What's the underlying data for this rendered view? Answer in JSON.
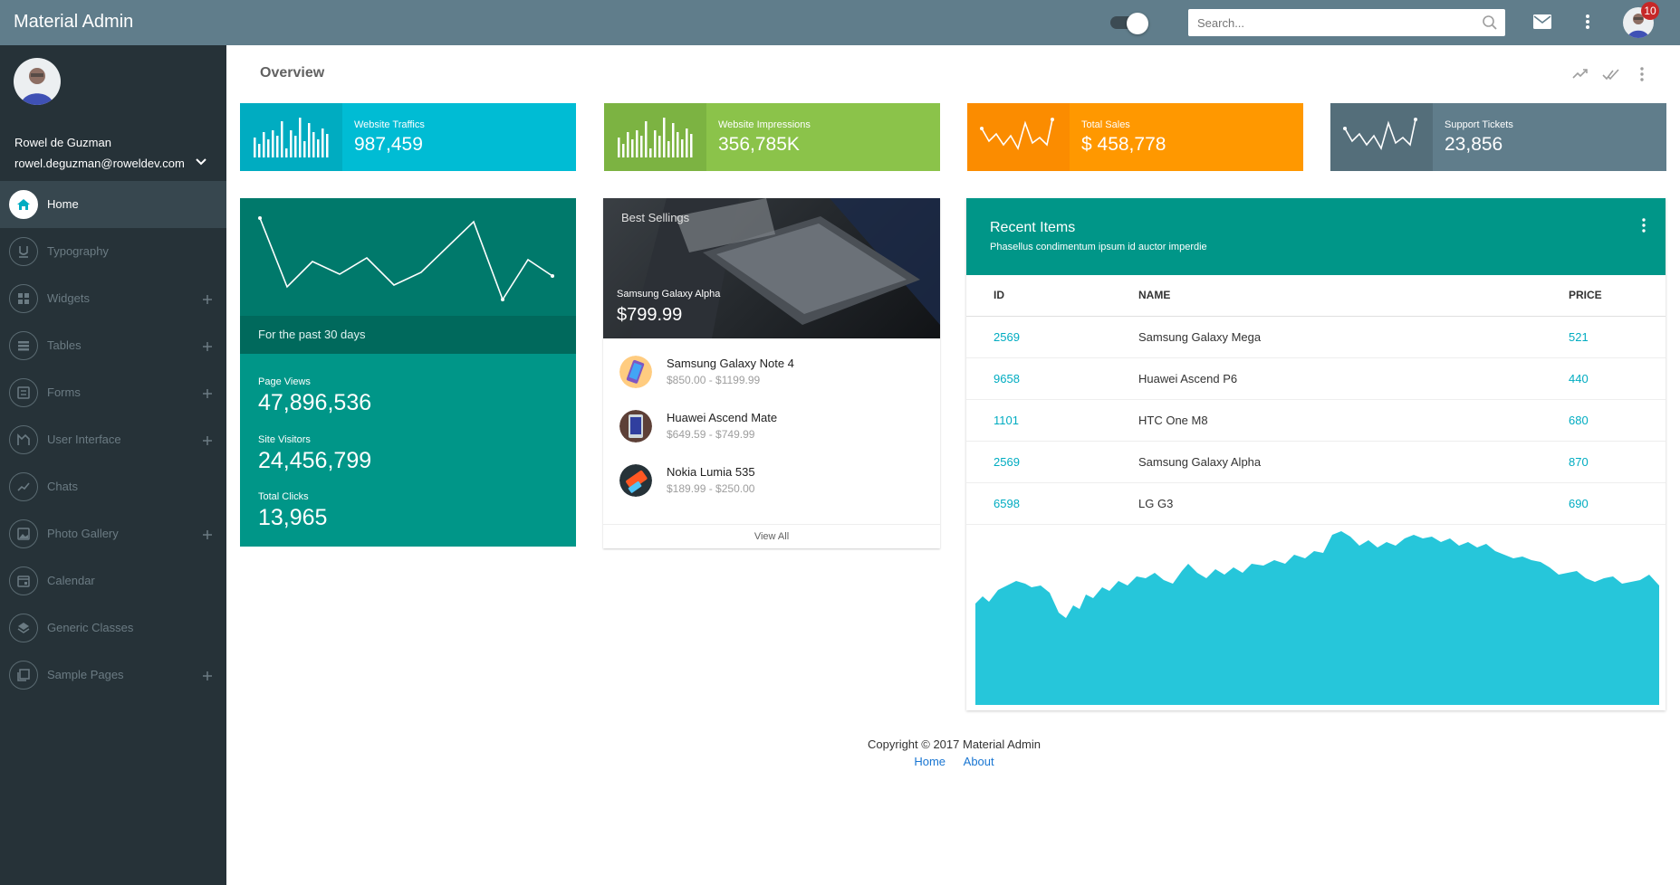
{
  "header": {
    "brand": "Material Admin",
    "search_placeholder": "Search...",
    "notification_count": "10",
    "colors": {
      "bar": "#607d8b"
    }
  },
  "sidebar": {
    "user_name": "Rowel de Guzman",
    "user_email": "rowel.deguzman@roweldev.com",
    "items": [
      {
        "label": "Home",
        "icon": "home-icon",
        "active": true,
        "expandable": false
      },
      {
        "label": "Typography",
        "icon": "typography-icon",
        "active": false,
        "expandable": false
      },
      {
        "label": "Widgets",
        "icon": "widgets-icon",
        "active": false,
        "expandable": true
      },
      {
        "label": "Tables",
        "icon": "tables-icon",
        "active": false,
        "expandable": true
      },
      {
        "label": "Forms",
        "icon": "forms-icon",
        "active": false,
        "expandable": true
      },
      {
        "label": "User Interface",
        "icon": "user-interface-icon",
        "active": false,
        "expandable": true
      },
      {
        "label": "Chats",
        "icon": "chats-icon",
        "active": false,
        "expandable": false
      },
      {
        "label": "Photo Gallery",
        "icon": "photo-gallery-icon",
        "active": false,
        "expandable": true
      },
      {
        "label": "Calendar",
        "icon": "calendar-icon",
        "active": false,
        "expandable": false
      },
      {
        "label": "Generic Classes",
        "icon": "generic-classes-icon",
        "active": false,
        "expandable": false
      },
      {
        "label": "Sample Pages",
        "icon": "sample-pages-icon",
        "active": false,
        "expandable": true
      }
    ]
  },
  "content": {
    "title": "Overview",
    "stats": [
      {
        "title": "Website Traffics",
        "value": "987,459",
        "color": "#00bcd4",
        "icon_color": "#00acc1",
        "icon": "bar-sparkline-icon"
      },
      {
        "title": "Website Impressions",
        "value": "356,785K",
        "color": "#8bc34a",
        "icon_color": "#7cb342",
        "icon": "bar-sparkline-icon"
      },
      {
        "title": "Total Sales",
        "value": "$ 458,778",
        "color": "#ff9800",
        "icon_color": "#fb8c00",
        "icon": "line-sparkline-icon"
      },
      {
        "title": "Support Tickets",
        "value": "23,856",
        "color": "#607d8b",
        "icon_color": "#546e7a",
        "icon": "line-sparkline-icon"
      }
    ],
    "traffic": {
      "period": "For the past 30 days",
      "metrics": [
        {
          "label": "Page Views",
          "value": "47,896,536"
        },
        {
          "label": "Site Visitors",
          "value": "24,456,799"
        },
        {
          "label": "Total Clicks",
          "value": "13,965"
        }
      ]
    },
    "best_sellings": {
      "title": "Best Sellings",
      "featured_name": "Samsung Galaxy Alpha",
      "featured_price": "$799.99",
      "items": [
        {
          "name": "Samsung Galaxy Note 4",
          "price": "$850.00 - $1199.99"
        },
        {
          "name": "Huawei Ascend Mate",
          "price": "$649.59 - $749.99"
        },
        {
          "name": "Nokia Lumia 535",
          "price": "$189.99 - $250.00"
        }
      ],
      "view_all": "View All"
    },
    "recent_items": {
      "title": "Recent Items",
      "subtitle": "Phasellus condimentum ipsum id auctor imperdie",
      "columns": [
        "ID",
        "NAME",
        "PRICE"
      ],
      "rows": [
        {
          "id": "2569",
          "name": "Samsung Galaxy Mega",
          "price": "521"
        },
        {
          "id": "9658",
          "name": "Huawei Ascend P6",
          "price": "440"
        },
        {
          "id": "1101",
          "name": "HTC One M8",
          "price": "680"
        },
        {
          "id": "2569",
          "name": "Samsung Galaxy Alpha",
          "price": "870"
        },
        {
          "id": "6598",
          "name": "LG G3",
          "price": "690"
        }
      ],
      "area_color": "#26c6da"
    }
  },
  "footer": {
    "copyright": "Copyright © 2017 Material Admin",
    "links": [
      "Home",
      "About"
    ]
  }
}
